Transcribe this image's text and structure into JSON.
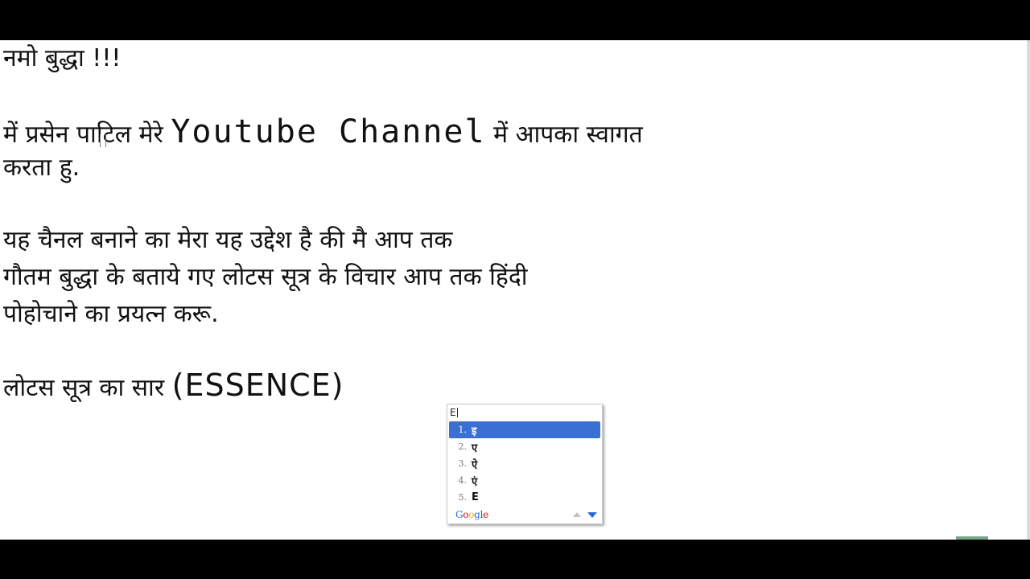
{
  "document": {
    "line1": "नमो बुद्धा !!!",
    "line2_pre": "में प्रसेन पाटिल मेरे ",
    "line2_latin": "Youtube Channel",
    "line2_post": " में आपका स्वागत",
    "line3": "करता हु.",
    "line4": "यह चैनल बनाने का मेरा यह उद्देश है की मै आप तक",
    "line5": "गौतम बुद्धा के बताये गए लोटस सूत्र के विचार आप तक हिंदी",
    "line6": "पोहोचाने का प्रयत्न करू.",
    "line7_pre": "लोटस सूत्र का सार ",
    "line7_latin": "(ESSENCE)"
  },
  "ime": {
    "typed": "E",
    "candidates": [
      {
        "num": "1.",
        "text": "इ",
        "selected": true
      },
      {
        "num": "2.",
        "text": "ए",
        "selected": false
      },
      {
        "num": "3.",
        "text": "ऐ",
        "selected": false
      },
      {
        "num": "4.",
        "text": "एं",
        "selected": false
      },
      {
        "num": "5.",
        "text": "E",
        "selected": false
      }
    ],
    "footer_logo": [
      "G",
      "o",
      "o",
      "g",
      "l",
      "e"
    ],
    "colors": {
      "selection": "#3a6fd4",
      "logo": [
        "#3369e8",
        "#d50f25",
        "#eeb211",
        "#3369e8",
        "#009925",
        "#d50f25"
      ]
    },
    "icons": [
      "scroll-up-arrow-icon",
      "scroll-down-arrow-icon"
    ]
  }
}
